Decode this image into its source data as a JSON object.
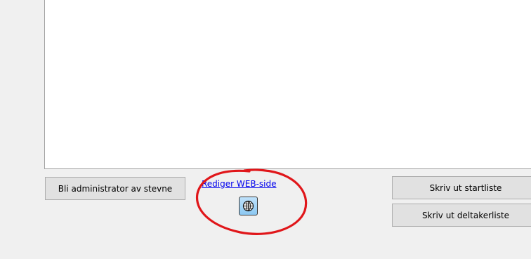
{
  "buttons": {
    "admin_label": "Bli administrator av stevne",
    "startliste_label": "Skriv ut startliste",
    "deltakerliste_label": "Skriv ut deltakerliste"
  },
  "web": {
    "link_label": "Rediger WEB-side",
    "icon": "globe-icon"
  },
  "colors": {
    "annotation": "#e0161a",
    "link": "#0000ee",
    "globe_button": "#9fd2f6"
  }
}
